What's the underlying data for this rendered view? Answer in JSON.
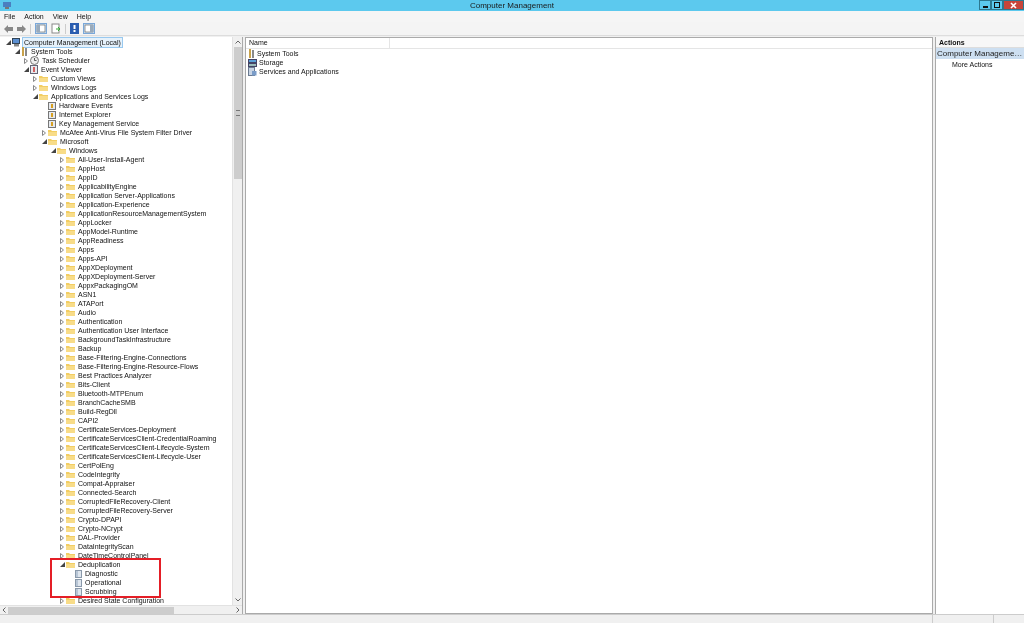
{
  "window": {
    "title": "Computer Management"
  },
  "menu": [
    "File",
    "Action",
    "View",
    "Help"
  ],
  "tree": [
    {
      "label": "Computer Management (Local)",
      "kind": "computer",
      "selected": true,
      "expanded": true,
      "children": [
        {
          "label": "System Tools",
          "kind": "tools",
          "selected": false,
          "expanded": true,
          "children": [
            {
              "label": "Task Scheduler",
              "kind": "clock",
              "selected": false,
              "expanded": false
            },
            {
              "label": "Event Viewer",
              "kind": "viewer",
              "selected": false,
              "expanded": true,
              "children": [
                {
                  "label": "Custom Views",
                  "kind": "folder",
                  "selected": false,
                  "expanded": false
                },
                {
                  "label": "Windows Logs",
                  "kind": "folder",
                  "selected": false,
                  "expanded": false
                },
                {
                  "label": "Applications and Services Logs",
                  "kind": "folder",
                  "selected": false,
                  "expanded": true,
                  "children": [
                    {
                      "label": "Hardware Events",
                      "kind": "eventlog",
                      "selected": false
                    },
                    {
                      "label": "Internet Explorer",
                      "kind": "eventlog",
                      "selected": false
                    },
                    {
                      "label": "Key Management Service",
                      "kind": "eventlog",
                      "selected": false
                    },
                    {
                      "label": "McAfee Anti-Virus File System Filter Driver",
                      "kind": "folder",
                      "selected": false,
                      "expanded": false
                    },
                    {
                      "label": "Microsoft",
                      "kind": "folder",
                      "selected": false,
                      "expanded": true,
                      "children": [
                        {
                          "label": "Windows",
                          "kind": "folder",
                          "selected": false,
                          "expanded": true,
                          "children": [
                            {
                              "label": "All-User-Install-Agent",
                              "kind": "folder",
                              "selected": false,
                              "expanded": false
                            },
                            {
                              "label": "AppHost",
                              "kind": "folder",
                              "selected": false,
                              "expanded": false
                            },
                            {
                              "label": "AppID",
                              "kind": "folder",
                              "selected": false,
                              "expanded": false
                            },
                            {
                              "label": "ApplicabilityEngine",
                              "kind": "folder",
                              "selected": false,
                              "expanded": false
                            },
                            {
                              "label": "Application Server-Applications",
                              "kind": "folder",
                              "selected": false,
                              "expanded": false
                            },
                            {
                              "label": "Application-Experience",
                              "kind": "folder",
                              "selected": false,
                              "expanded": false
                            },
                            {
                              "label": "ApplicationResourceManagementSystem",
                              "kind": "folder",
                              "selected": false,
                              "expanded": false
                            },
                            {
                              "label": "AppLocker",
                              "kind": "folder",
                              "selected": false,
                              "expanded": false
                            },
                            {
                              "label": "AppModel-Runtime",
                              "kind": "folder",
                              "selected": false,
                              "expanded": false
                            },
                            {
                              "label": "AppReadiness",
                              "kind": "folder",
                              "selected": false,
                              "expanded": false
                            },
                            {
                              "label": "Apps",
                              "kind": "folder",
                              "selected": false,
                              "expanded": false
                            },
                            {
                              "label": "Apps-API",
                              "kind": "folder",
                              "selected": false,
                              "expanded": false
                            },
                            {
                              "label": "AppXDeployment",
                              "kind": "folder",
                              "selected": false,
                              "expanded": false
                            },
                            {
                              "label": "AppXDeployment-Server",
                              "kind": "folder",
                              "selected": false,
                              "expanded": false
                            },
                            {
                              "label": "AppxPackagingOM",
                              "kind": "folder",
                              "selected": false,
                              "expanded": false
                            },
                            {
                              "label": "ASN1",
                              "kind": "folder",
                              "selected": false,
                              "expanded": false
                            },
                            {
                              "label": "ATAPort",
                              "kind": "folder",
                              "selected": false,
                              "expanded": false
                            },
                            {
                              "label": "Audio",
                              "kind": "folder",
                              "selected": false,
                              "expanded": false
                            },
                            {
                              "label": "Authentication",
                              "kind": "folder",
                              "selected": false,
                              "expanded": false
                            },
                            {
                              "label": "Authentication User Interface",
                              "kind": "folder",
                              "selected": false,
                              "expanded": false
                            },
                            {
                              "label": "BackgroundTaskInfrastructure",
                              "kind": "folder",
                              "selected": false,
                              "expanded": false
                            },
                            {
                              "label": "Backup",
                              "kind": "folder",
                              "selected": false,
                              "expanded": false
                            },
                            {
                              "label": "Base-Filtering-Engine-Connections",
                              "kind": "folder",
                              "selected": false,
                              "expanded": false
                            },
                            {
                              "label": "Base-Filtering-Engine-Resource-Flows",
                              "kind": "folder",
                              "selected": false,
                              "expanded": false
                            },
                            {
                              "label": "Best Practices Analyzer",
                              "kind": "folder",
                              "selected": false,
                              "expanded": false
                            },
                            {
                              "label": "Bits-Client",
                              "kind": "folder",
                              "selected": false,
                              "expanded": false
                            },
                            {
                              "label": "Bluetooth-MTPEnum",
                              "kind": "folder",
                              "selected": false,
                              "expanded": false
                            },
                            {
                              "label": "BranchCacheSMB",
                              "kind": "folder",
                              "selected": false,
                              "expanded": false
                            },
                            {
                              "label": "Build-RegDll",
                              "kind": "folder",
                              "selected": false,
                              "expanded": false
                            },
                            {
                              "label": "CAPI2",
                              "kind": "folder",
                              "selected": false,
                              "expanded": false
                            },
                            {
                              "label": "CertificateServices-Deployment",
                              "kind": "folder",
                              "selected": false,
                              "expanded": false
                            },
                            {
                              "label": "CertificateServicesClient-CredentialRoaming",
                              "kind": "folder",
                              "selected": false,
                              "expanded": false
                            },
                            {
                              "label": "CertificateServicesClient-Lifecycle-System",
                              "kind": "folder",
                              "selected": false,
                              "expanded": false
                            },
                            {
                              "label": "CertificateServicesClient-Lifecycle-User",
                              "kind": "folder",
                              "selected": false,
                              "expanded": false
                            },
                            {
                              "label": "CertPolEng",
                              "kind": "folder",
                              "selected": false,
                              "expanded": false
                            },
                            {
                              "label": "CodeIntegrity",
                              "kind": "folder",
                              "selected": false,
                              "expanded": false
                            },
                            {
                              "label": "Compat-Appraiser",
                              "kind": "folder",
                              "selected": false,
                              "expanded": false
                            },
                            {
                              "label": "Connected-Search",
                              "kind": "folder",
                              "selected": false,
                              "expanded": false
                            },
                            {
                              "label": "CorruptedFileRecovery-Client",
                              "kind": "folder",
                              "selected": false,
                              "expanded": false
                            },
                            {
                              "label": "CorruptedFileRecovery-Server",
                              "kind": "folder",
                              "selected": false,
                              "expanded": false
                            },
                            {
                              "label": "Crypto-DPAPI",
                              "kind": "folder",
                              "selected": false,
                              "expanded": false
                            },
                            {
                              "label": "Crypto-NCrypt",
                              "kind": "folder",
                              "selected": false,
                              "expanded": false
                            },
                            {
                              "label": "DAL-Provider",
                              "kind": "folder",
                              "selected": false,
                              "expanded": false
                            },
                            {
                              "label": "DataIntegrityScan",
                              "kind": "folder",
                              "selected": false,
                              "expanded": false
                            },
                            {
                              "label": "DateTimeControlPanel",
                              "kind": "folder",
                              "selected": false,
                              "expanded": false
                            },
                            {
                              "label": "Deduplication",
                              "kind": "folder",
                              "selected": false,
                              "expanded": true,
                              "highlighted": true,
                              "children": [
                                {
                                  "label": "Diagnostic",
                                  "kind": "log",
                                  "selected": false
                                },
                                {
                                  "label": "Operational",
                                  "kind": "log",
                                  "selected": false
                                },
                                {
                                  "label": "Scrubbing",
                                  "kind": "log",
                                  "selected": false
                                }
                              ]
                            },
                            {
                              "label": "Desired State Configuration",
                              "kind": "folder",
                              "selected": false,
                              "expanded": false
                            }
                          ]
                        }
                      ]
                    }
                  ]
                }
              ]
            }
          ]
        }
      ]
    }
  ],
  "list": {
    "columns": [
      "Name"
    ],
    "rows": [
      {
        "name": "System Tools",
        "kind": "tools"
      },
      {
        "name": "Storage",
        "kind": "storage"
      },
      {
        "name": "Services and Applications",
        "kind": "services"
      }
    ]
  },
  "actions": {
    "title": "Actions",
    "section": "Computer Manageme…",
    "items": [
      "More Actions"
    ]
  }
}
